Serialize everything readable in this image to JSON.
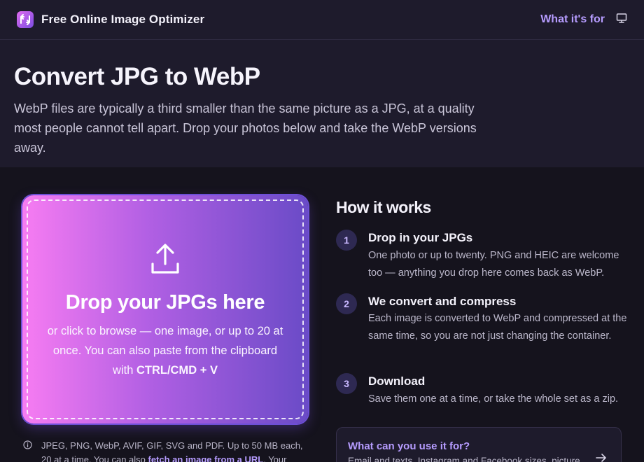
{
  "header": {
    "brand": "Free Online Image Optimizer",
    "nav_link": "What it's for",
    "icons": [
      "app-logo-icon",
      "monitor-icon"
    ]
  },
  "hero": {
    "title": "Convert JPG to WebP",
    "description": "WebP files are typically a third smaller than the same picture as a JPG, at a quality most people cannot tell apart. Drop your photos below and take the WebP versions away."
  },
  "dropzone": {
    "icon": "upload-icon",
    "title": "Drop your JPGs here",
    "subtitle": "or click to browse — one image, or up to 20 at once. You can also paste from the clipboard with ",
    "shortcut": "CTRL/CMD + V",
    "colors": {
      "start": "#f77cf2",
      "end": "#6a4bc7"
    }
  },
  "info": {
    "icon": "info-icon",
    "text_prefix": "JPEG, PNG, WebP, AVIF, GIF, SVG and PDF. Up to 50 MB each, 20 at a time. You can also ",
    "link": "fetch an image from a URL",
    "text_suffix": ". Your"
  },
  "how_it_works": {
    "heading": "How it works",
    "steps": [
      {
        "number": "1",
        "title": "Drop in your JPGs",
        "description": "One photo or up to twenty. PNG and HEIC are welcome too — anything you drop here comes back as WebP."
      },
      {
        "number": "2",
        "title": "We convert and compress",
        "description": "Each image is converted to WebP and compressed at the same time, so you are not just changing the container."
      },
      {
        "number": "3",
        "title": "Download",
        "description": "Save them one at a time, or take the whole set as a zip."
      }
    ]
  },
  "uses_card": {
    "title": "What can you use it for?",
    "description": "Email and texts, Instagram and Facebook sizes, picture",
    "icon": "arrow-right-icon"
  },
  "colors": {
    "accent": "#b69cff",
    "background": "#15131d",
    "surface": "#1e1b2c"
  }
}
